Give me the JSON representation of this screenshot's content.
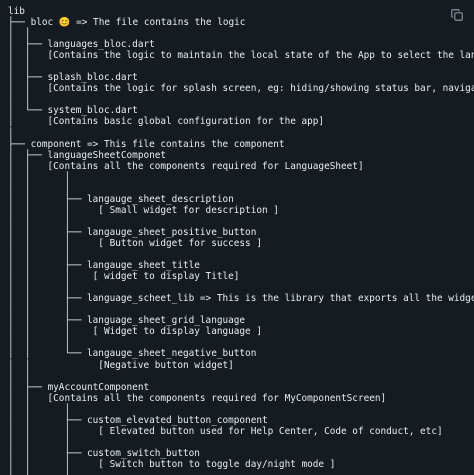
{
  "code_block": {
    "copy_icon": "copy-icon",
    "lines": [
      "lib",
      "├── bloc 😊 => The file contains the logic",
      "│  │",
      "│  ├── languages_bloc.dart",
      "│  │   [Contains the logic to maintain the local state of the App to select the language by reverpo",
      "│  │",
      "│  ├── splash_bloc.dart",
      "│  │   [Contains the logic for splash screen, eg: hiding/showing status bar, navigate]",
      "│  │",
      "│  └── system_bloc.dart",
      "│      [Contains basic global configuration for the app]",
      "│",
      "├── component => This file contains the component",
      "│  ├── languageSheetComponet",
      "│  │   [Contains all the components required for LanguageSheet]",
      "│  │      │",
      "│  │      │",
      "│  │      ├── langauge_sheet_description",
      "│  │      │     [ Small widget for description ]",
      "│  │      │",
      "│  │      ├── langauge_sheet_positive_button",
      "│  │      │     [ Button widget for success ]",
      "│  │      │",
      "│  │      ├── langauge_sheet_title",
      "│  │      │    [ widget to display Title]",
      "│  │      │",
      "│  │      ├── language_scheet_lib => This is the library that exports all the widget in this tree",
      "│  │      │",
      "│  │      ├── language_sheet_grid_language",
      "│  │      │    [ Widget to display language ]",
      "│  │      │",
      "│  │      └── langauge_sheet_negative_button",
      "│  │            [Negative button widget]",
      "│  │",
      "│  ├── myAccountComponent",
      "│  │   [Contains all the components required for MyComponentScreen]",
      "│  │      │",
      "│  │      ├── custom_elevated_button_component",
      "│  │      │     [ Elevated button used for Help Center, Code of conduct, etc]",
      "│  │      │",
      "│  │      ├── custom_switch_button",
      "│  │      │     [ Switch button to toggle day/night mode ]",
      "│  │      │",
      "│  │      │"
    ]
  }
}
